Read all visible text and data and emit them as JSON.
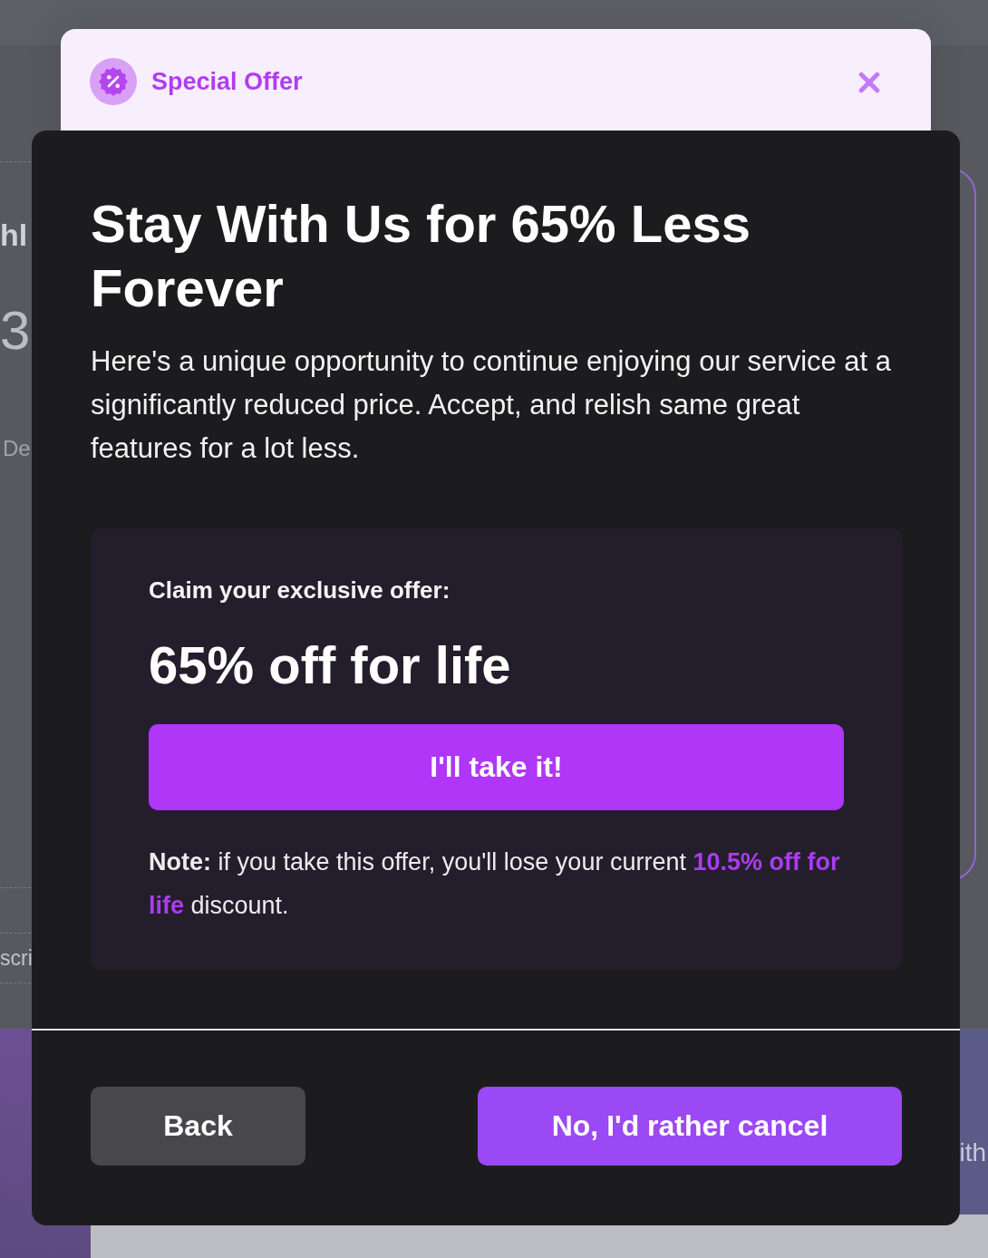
{
  "background_page": {
    "left_texts": [
      {
        "text": "hl",
        "kind": "heading"
      },
      {
        "text": "3",
        "kind": "figure"
      },
      {
        "text": "De",
        "kind": "caption"
      },
      {
        "text": "scri",
        "kind": "tab"
      }
    ],
    "right_text": "ith"
  },
  "dialog": {
    "header": {
      "title": "Special Offer"
    },
    "title": "Stay With Us for 65% Less Forever",
    "description": "Here's a unique opportunity to continue enjoying our service at a significantly reduced price. Accept, and relish same great features for a lot less.",
    "offer": {
      "label": "Claim your exclusive offer:",
      "headline": "65% off for life",
      "accept_button": "I'll take it!",
      "note": [
        {
          "text": "Note:",
          "kind": "label"
        },
        {
          "text": " if you take this offer, you'll lose your current ",
          "kind": "plain"
        },
        {
          "text": "10.5% off for life",
          "kind": "highlight"
        },
        {
          "text": " discount.",
          "kind": "plain"
        }
      ]
    },
    "buttons": [
      {
        "label": "Back",
        "kind": "secondary"
      },
      {
        "label": "No, I'd rather cancel",
        "kind": "primary"
      }
    ]
  }
}
